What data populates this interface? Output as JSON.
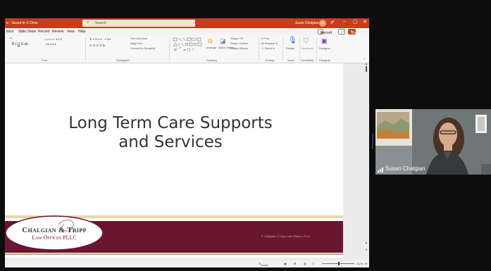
{
  "titlebar": {
    "doc": "e - Saved to X Drive",
    "search_placeholder": "Search",
    "user": "Susie Chalgian",
    "user_initials": "SC"
  },
  "menu": {
    "items": [
      "tions",
      "Slide Show",
      "Record",
      "Review",
      "View",
      "Help"
    ],
    "record_button": "Record",
    "share_button": "Share"
  },
  "ribbon": {
    "font_group": "Font",
    "paragraph_group": "Paragraph",
    "drawing_group": "Drawing",
    "editing_group": "Editing",
    "voice_group": "Voice",
    "sensitivity_group": "Sensitivity",
    "designer_group": "Designer",
    "text_direction": "Text Direction",
    "align_text": "Align Text",
    "convert_smartart": "Convert to SmartArt",
    "arrange": "Arrange",
    "quick_styles": "Quick Styles",
    "shape_fill": "Shape Fill",
    "shape_outline": "Shape Outline",
    "shape_effects": "Shape Effects",
    "find": "Find",
    "replace": "Replace",
    "select": "Select",
    "dictate": "Dictate",
    "sensitivity": "Sensitivity",
    "designer": "Designer"
  },
  "slide": {
    "title": "Long Term Care Supports\nand Services",
    "logo_line1": "Chalgian & Tripp",
    "logo_line2": "Law Offices PLLC",
    "copyright": "© Chalgian & Tripp Law Offices, PLLC"
  },
  "statusbar": {
    "notes": "Notes",
    "zoom": "111%"
  },
  "video": {
    "participant": "Susan Chalgian"
  },
  "colors": {
    "ppt_accent": "#c43e1c",
    "slide_band": "#6b1630",
    "slide_gold": "#e8d8a8"
  }
}
